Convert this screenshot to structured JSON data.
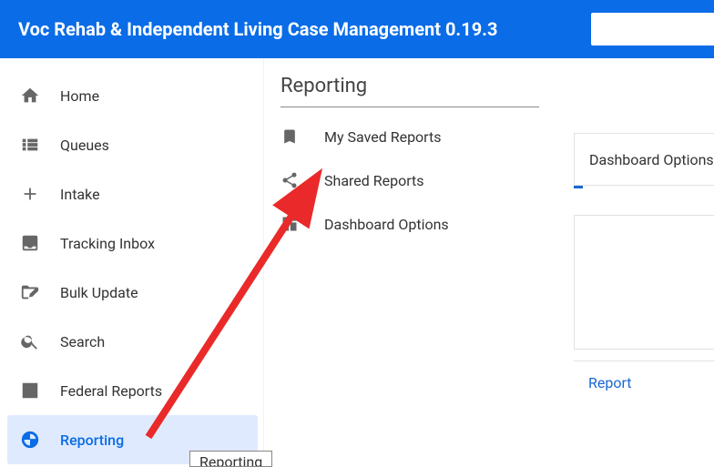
{
  "header": {
    "title": "Voc Rehab & Independent Living Case Management 0.19.3"
  },
  "sidebar": {
    "items": [
      {
        "label": "Home"
      },
      {
        "label": "Queues"
      },
      {
        "label": "Intake"
      },
      {
        "label": "Tracking Inbox"
      },
      {
        "label": "Bulk Update"
      },
      {
        "label": "Search"
      },
      {
        "label": "Federal Reports"
      },
      {
        "label": "Reporting"
      }
    ]
  },
  "panel": {
    "title": "Reporting",
    "items": [
      {
        "label": "My Saved Reports"
      },
      {
        "label": "Shared Reports"
      },
      {
        "label": "Dashboard Options"
      }
    ]
  },
  "right": {
    "dashboard_title": "Dashboard Options",
    "report_link": "Report"
  },
  "tooltip": "Reporting"
}
